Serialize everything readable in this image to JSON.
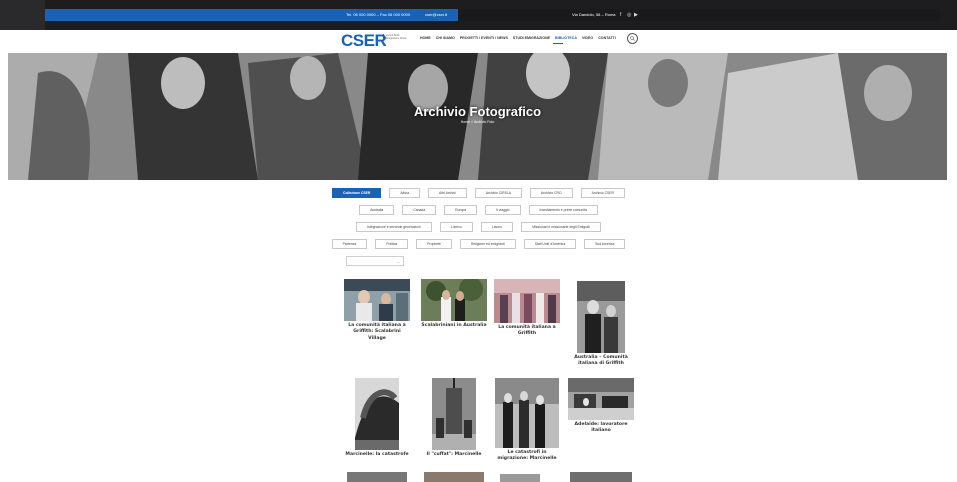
{
  "topbar": {
    "phone": "Tel. 06 000 0000 – Fax 06 000 0000",
    "email": "cser@cser.it",
    "address": "Via Dandolo, 58 – Roma"
  },
  "header": {
    "logo": "CSER",
    "logo_sub": "Centro Studi Emigrazione Roma",
    "nav": [
      "HOME",
      "CHI SIAMO",
      "PROGETTI / EVENTI / NEWS",
      "STUDI EMIGRAZIONE",
      "BIBLIOTECA",
      "VIDEO",
      "CONTATTI"
    ],
    "active_nav": "BIBLIOTECA"
  },
  "hero": {
    "title": "Archivio Fotografico",
    "breadcrumb": "Home  >  Archivio Foto"
  },
  "filters": {
    "row1": [
      "Collezione CSER",
      "Africa",
      "Altri Archivi",
      "Archivio CIRSLA",
      "Archivio CRO",
      "Archivio CSER"
    ],
    "row2": [
      "Australia",
      "Canada",
      "Europa",
      "Il viaggio",
      "Insediamento e prime comunità"
    ],
    "row3": [
      "Integrazione e seconde generazioni",
      "L'arrivo",
      "Lavoro",
      "Missionari e missionarie degli Emigrati"
    ],
    "row4": [
      "Partenza",
      "Politica",
      "Propriete",
      "Religione ed emigranti",
      "Stati Uniti d'America",
      "Sud America"
    ],
    "active": "Collezione CSER",
    "select_placeholder": ""
  },
  "gallery": [
    {
      "title": "La comunità italiana a Griffith: Scalabrini Village"
    },
    {
      "title": "Scalabriniani in Australia"
    },
    {
      "title": "La comunità italiana a Griffith"
    },
    {
      "title": "Australia – Comunità italiana di Griffith"
    },
    {
      "title": "Marcinelle: la catastrofe"
    },
    {
      "title": "Il \"cuffat\": Marcinelle"
    },
    {
      "title": "Le catastrofi in migrazione: Marcinelle"
    },
    {
      "title": "Adelaide: lavoratore italiano"
    }
  ],
  "colors": {
    "accent": "#1c62b4",
    "topbar": "#1d1d1f"
  }
}
